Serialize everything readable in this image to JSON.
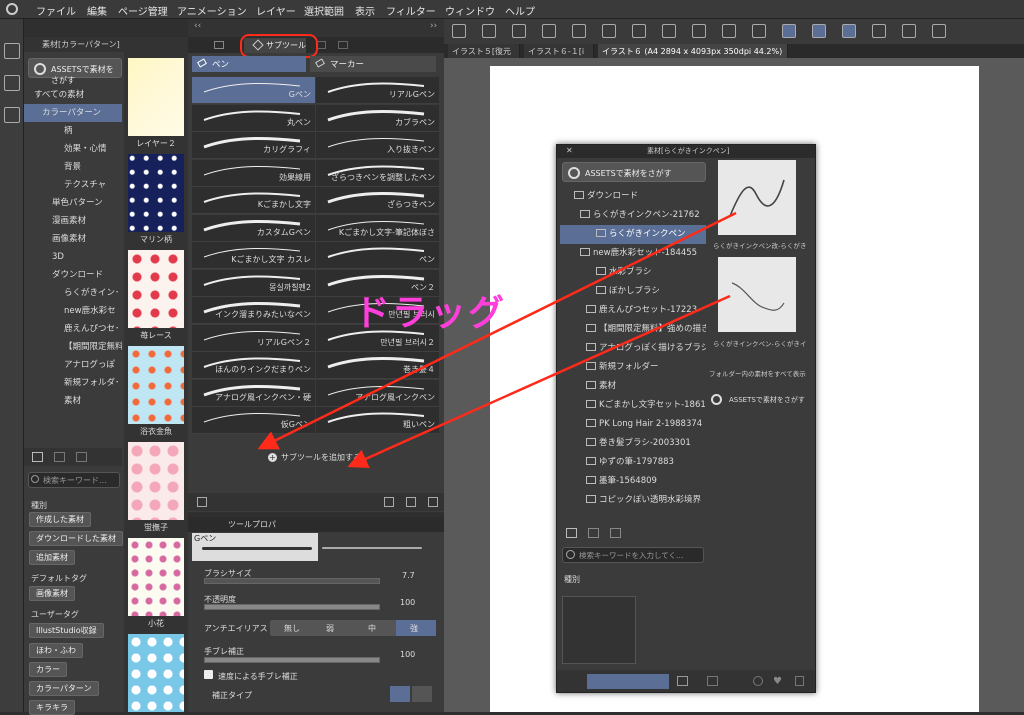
{
  "menu": [
    "ファイル",
    "編集",
    "ページ管理",
    "アニメーション",
    "レイヤー",
    "選択範囲",
    "表示",
    "フィルター",
    "ウィンドウ",
    "ヘルプ"
  ],
  "material_panel": {
    "title": "素材[カラーパターン]",
    "assets_button": "ASSETSで素材をさがす",
    "tree": [
      "すべての素材",
      "カラーパターン",
      "柄",
      "効果・心情",
      "背景",
      "テクスチャ",
      "単色パターン",
      "漫画素材",
      "画像素材",
      "3D",
      "ダウンロード",
      "らくがきイン･",
      "new鹿水彩セ",
      "鹿えんぴつセ･",
      "【期間限定無料",
      "アナログっぽ",
      "新規フォルダ･",
      "素材"
    ],
    "search_placeholder": "検索キーワード…",
    "kind_label": "種別",
    "kind_buttons": [
      "作成した素材",
      "ダウンロードした素材",
      "追加素材"
    ],
    "default_tag_label": "デフォルトタグ",
    "default_tags": [
      "画像素材"
    ],
    "user_tag_label": "ユーザータグ",
    "user_tags": [
      "IllustStudio収録",
      "ほわ・ふわ",
      "カラー",
      "カラーパターン",
      "キラキラ"
    ],
    "thumbs": [
      "レイヤー２",
      "マリン柄",
      "苺レース",
      "浴衣金魚",
      "蛍撫子",
      "小花",
      ""
    ]
  },
  "subtool": {
    "tab_label": "サブツール",
    "pen_tab": "ペン",
    "marker_tab": "マーカー",
    "brushes_left": [
      "Gペン",
      "丸ペン",
      "カリグラフィ",
      "効果線用",
      "Kごまかし文字",
      "カスタムGペン",
      "Kごまかし文字 カスレ",
      "몽실까칠펜2",
      "インク溜まりみたいなペン",
      "リアルGペン２",
      "ほんのりインクだまりペン",
      "アナログ風インクペン・硬",
      "仮Gペン"
    ],
    "brushes_right": [
      "リアルGペン",
      "カブラペン",
      "入り抜きペン",
      "ざらつきペンを調整したペン",
      "ざらつきペン",
      "Kごまかし文字-筆記体ぼさ",
      "ペン",
      "ペン２",
      "만년필 브러시",
      "만년필 브러시２",
      "巻き髪４",
      "アナログ風インクペン",
      "粗いペン"
    ],
    "add_label": "サブツールを追加する"
  },
  "toolprop": {
    "title": "ツールプロパ",
    "brush_name": "Gペン",
    "brush_size_label": "ブラシサイズ",
    "brush_size": "7.7",
    "opacity_label": "不透明度",
    "opacity": "100",
    "aa_label": "アンチエイリアス",
    "aa_options": [
      "無し",
      "弱",
      "中",
      "強"
    ],
    "stab_label": "手ブレ補正",
    "stab_value": "100",
    "speed_label": "速度による手ブレ補正",
    "correction_label": "補正タイプ"
  },
  "tabs": [
    "イラスト５[復元",
    "イラスト６-１[i",
    "イラスト６ (A4 2894 x 4093px 350dpi 44.2%)"
  ],
  "float_panel": {
    "title": "素材[らくがきインクペン]",
    "assets_button": "ASSETSで素材をさがす",
    "tree": [
      "ダウンロード",
      "らくがきインクペン-21762",
      "らくがきインクペン",
      "new鹿水彩セット-184455",
      "水彩ブラシ",
      "ぼかしブラシ",
      "鹿えんぴつセット-17223",
      "【期間限定無料】強めの描き",
      "アナログっぽく描けるブラシ",
      "新規フォルダー",
      "素材",
      "Kごまかし文字セット-1861",
      "PK Long Hair 2-1988374",
      "巻き髪ブラシ-2003301",
      "ゆずの筆-1797883",
      "墨筆-1564809",
      "コピックぽい透明水彩境界"
    ],
    "thumb_labels": [
      "らくがきインクペン改-らくがき",
      "らくがきインクペン-らくがきイ"
    ],
    "show_all": "フォルダー内の素材をすべて表示",
    "assets_link": "ASSETSで素材をさがす",
    "search_placeholder": "検索キーワードを入力してく…",
    "kind_label": "種別"
  },
  "annotation": "ドラッグ",
  "colors": {
    "accent": "#5b6e96",
    "annotation": "#ff3fdc",
    "arrow": "#ff2a1a",
    "highlight": "#ff2a1a"
  }
}
